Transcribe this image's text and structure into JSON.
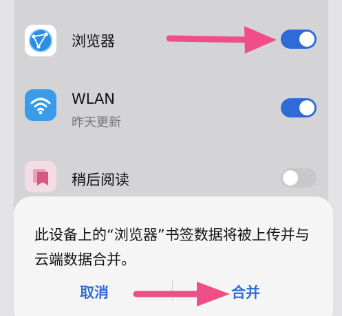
{
  "items": [
    {
      "label": "浏览器",
      "subtitle": "",
      "enabled": true,
      "icon": "browser-icon"
    },
    {
      "label": "WLAN",
      "subtitle": "昨天更新",
      "enabled": true,
      "icon": "wifi-icon"
    },
    {
      "label": "稍后阅读",
      "subtitle": "",
      "enabled": false,
      "icon": "read-later-icon"
    }
  ],
  "dialog": {
    "message": "此设备上的“浏览器”书签数据将被上传并与云端数据合并。",
    "cancel_label": "取消",
    "merge_label": "合并"
  },
  "colors": {
    "accent": "#2f6bd7",
    "arrow": "#ef4f86",
    "toggle_off": "#c8c8cb"
  }
}
